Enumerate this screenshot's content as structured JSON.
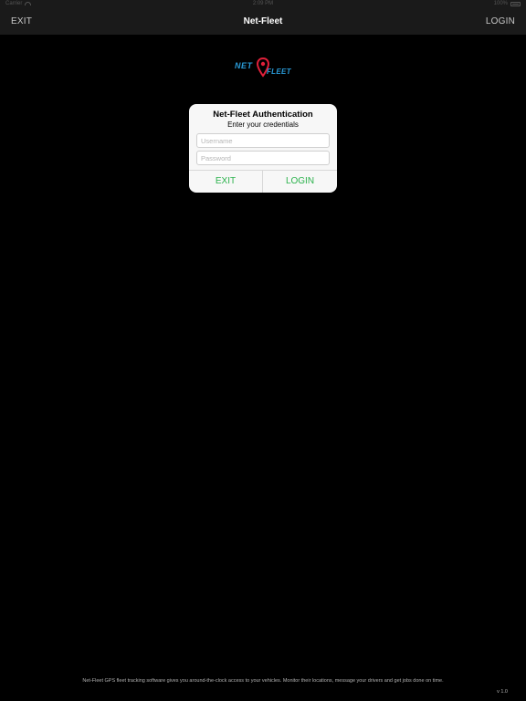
{
  "status_bar": {
    "carrier": "Carrier",
    "time": "2:09 PM",
    "battery": "100%"
  },
  "nav": {
    "left_label": "EXIT",
    "title": "Net-Fleet",
    "right_label": "LOGIN"
  },
  "logo": {
    "part1": "NET",
    "part2": "FLEET",
    "colors": {
      "blue": "#2a9bd8",
      "pin": "#e0203a"
    }
  },
  "dialog": {
    "title": "Net-Fleet Authentication",
    "message": "Enter your credentials",
    "username_placeholder": "Username",
    "password_placeholder": "Password",
    "exit_label": "EXIT",
    "login_label": "LOGIN",
    "button_color": "#2bb24c"
  },
  "footer": {
    "description": "Net-Fleet GPS fleet tracking software gives you around-the-clock access to your vehicles. Monitor their locations, message your drivers and get jobs done on time.",
    "version": "v 1.0"
  }
}
